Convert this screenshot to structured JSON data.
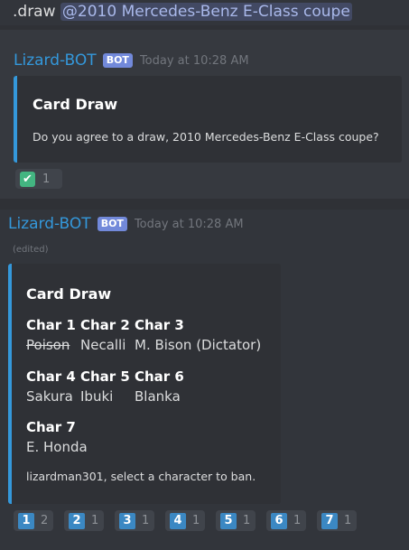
{
  "top_message": {
    "command": ".draw",
    "mention": "@2010 Mercedes-Benz E-Class coupe"
  },
  "message1": {
    "author": "Lizard-BOT",
    "bot_tag": "BOT",
    "timestamp": "Today at 10:28 AM",
    "embed": {
      "title": "Card Draw",
      "description": "Do you agree to a draw, 2010 Mercedes-Benz E-Class coupe?"
    },
    "reaction": {
      "emoji": "white-check-mark",
      "glyph": "✔",
      "count": "1"
    }
  },
  "message2": {
    "author": "Lizard-BOT",
    "bot_tag": "BOT",
    "timestamp": "Today at 10:28 AM",
    "edited": "(edited)",
    "embed": {
      "title": "Card Draw",
      "fields": [
        {
          "name": "Char 1",
          "value": "Poison",
          "struck": true
        },
        {
          "name": "Char 2",
          "value": "Necalli"
        },
        {
          "name": "Char 3",
          "value": "M. Bison (Dictator)"
        },
        {
          "name": "Char 4",
          "value": "Sakura"
        },
        {
          "name": "Char 5",
          "value": "Ibuki"
        },
        {
          "name": "Char 6",
          "value": "Blanka"
        },
        {
          "name": "Char 7",
          "value": "E. Honda"
        }
      ],
      "footer": "lizardman301, select a character to ban."
    },
    "reactions": [
      {
        "emoji": "1",
        "count": "2"
      },
      {
        "emoji": "2",
        "count": "1"
      },
      {
        "emoji": "3",
        "count": "1"
      },
      {
        "emoji": "4",
        "count": "1"
      },
      {
        "emoji": "5",
        "count": "1"
      },
      {
        "emoji": "6",
        "count": "1"
      },
      {
        "emoji": "7",
        "count": "1"
      }
    ]
  },
  "colors": {
    "accent": "#3498db",
    "bot_tag": "#7289da",
    "number_emoji": "#3b88c3",
    "check_emoji": "#43b581"
  }
}
